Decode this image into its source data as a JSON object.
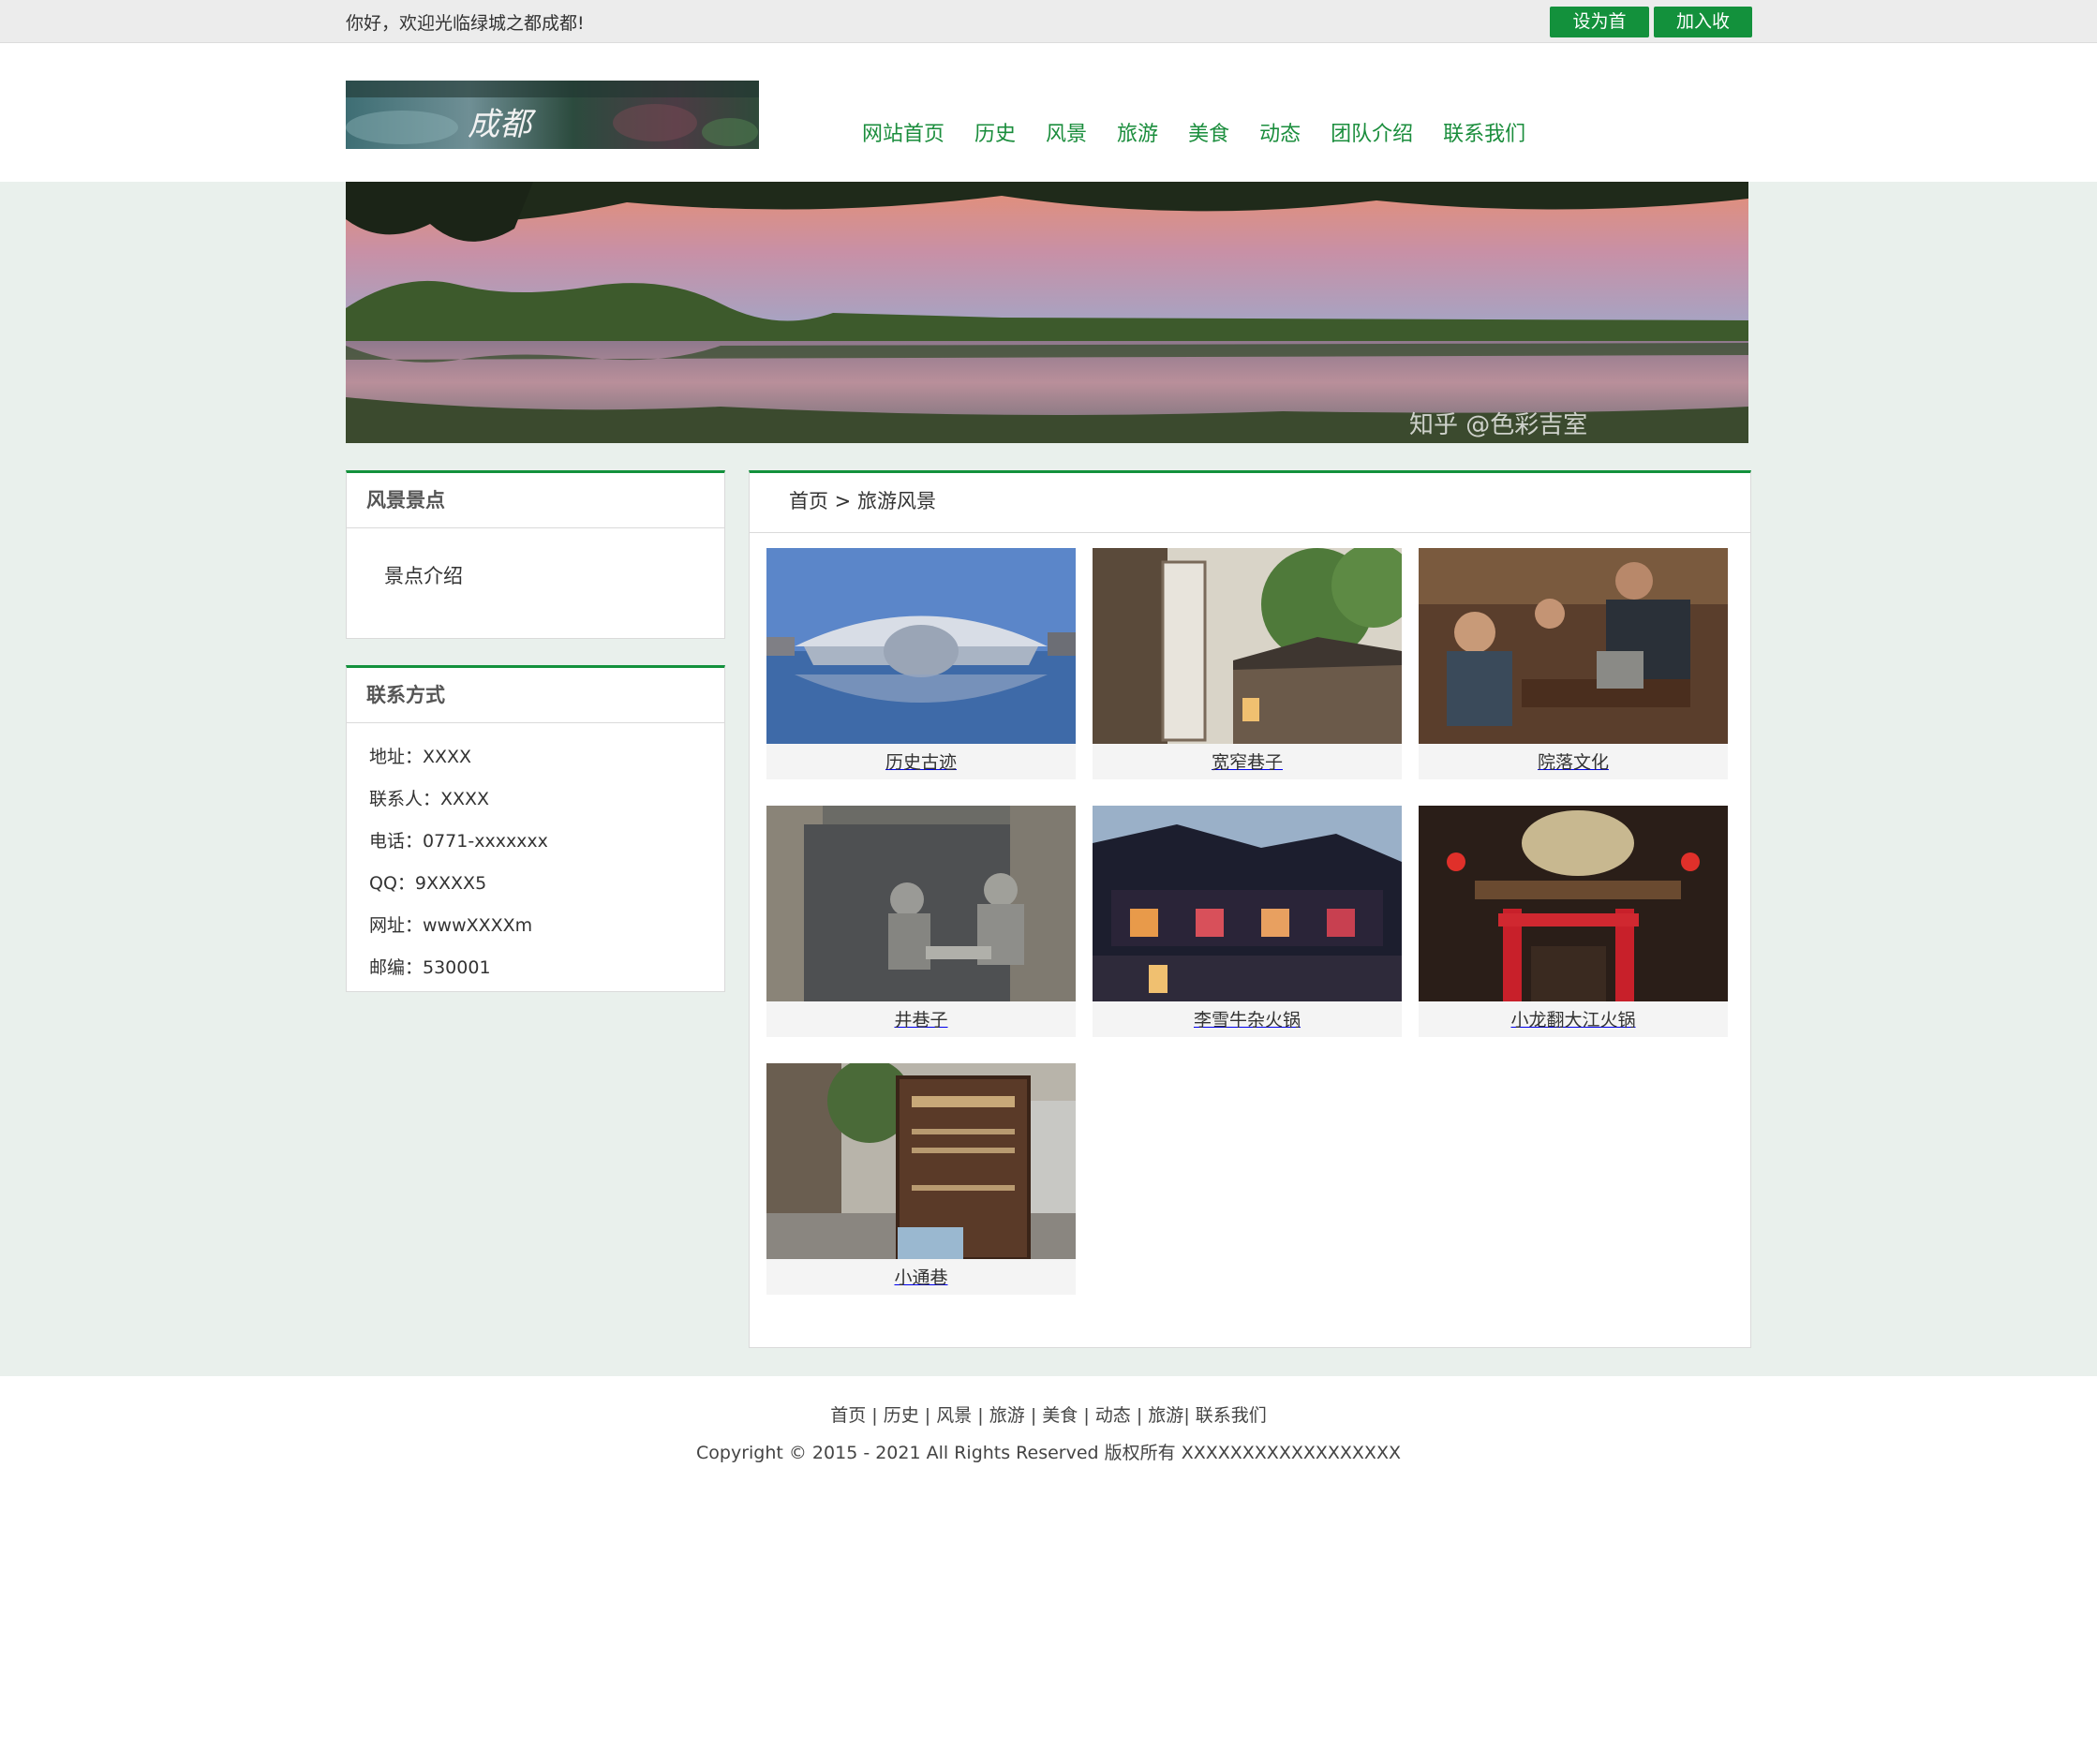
{
  "topbar": {
    "welcome": "你好，欢迎光临绿城之都成都!",
    "set_home_label": "设为首页",
    "add_favorite_label": "加入收藏"
  },
  "logo": {
    "text": "成都"
  },
  "nav": [
    {
      "label": "网站首页"
    },
    {
      "label": "历史"
    },
    {
      "label": "风景"
    },
    {
      "label": "旅游"
    },
    {
      "label": "美食"
    },
    {
      "label": "动态"
    },
    {
      "label": "团队介绍"
    },
    {
      "label": "联系我们"
    }
  ],
  "banner": {
    "watermark": "知乎 @色彩吉室"
  },
  "sidebar": {
    "scenic": {
      "title": "风景景点",
      "item": "景点介绍"
    },
    "contact": {
      "title": "联系方式",
      "items": [
        "地址：XXXX",
        "联系人：XXXX",
        "电话：0771-xxxxxxx",
        "QQ：9XXXX5",
        "网址：wwwXXXXm",
        "邮编：530001"
      ]
    }
  },
  "main": {
    "breadcrumb": "首页 > 旅游风景",
    "cards": [
      {
        "caption": "历史古迹",
        "image": "modern-building-reflection"
      },
      {
        "caption": "宽窄巷子",
        "image": "alley-sign"
      },
      {
        "caption": "院落文化",
        "image": "teahouse-people"
      },
      {
        "caption": "井巷子",
        "image": "stone-relief-wall"
      },
      {
        "caption": "李雪牛杂火锅",
        "image": "lit-pavilion-night"
      },
      {
        "caption": "小龙翻大江火锅",
        "image": "dragon-gate-restaurant"
      },
      {
        "caption": "小通巷",
        "image": "street-signboard"
      }
    ]
  },
  "footer": {
    "links": [
      "首页",
      "历史",
      "风景",
      "旅游",
      "美食",
      "动态",
      "旅游",
      "联系我们"
    ],
    "copyright": "Copyright © 2015 - 2021 All Rights Reserved 版权所有 XXXXXXXXXXXXXXXXXX"
  },
  "colors": {
    "accent": "#13913c",
    "band": "#e9f0ec"
  }
}
